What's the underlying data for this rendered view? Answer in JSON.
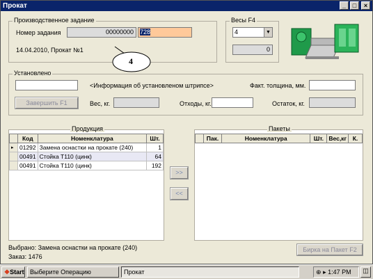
{
  "window": {
    "title": "Прокат"
  },
  "task": {
    "group_label": "Производственное задание",
    "number_label": "Номер задания",
    "number_value": "00000000",
    "number_edit_value": "728",
    "info": "14.04.2010, Прокат №1",
    "callout": "4"
  },
  "scales": {
    "group_label": "Весы  F4",
    "selected": "4",
    "reading": "0"
  },
  "installed": {
    "group_label": "Установлено",
    "strip_info": "<Информация об установленом штрипсе>",
    "thickness_label": "Факт. толщина, мм.",
    "finish_button": "Завершить     F1",
    "weight_label": "Вес, кг.",
    "waste_label": "Отходы, кг.",
    "remainder_label": "Остаток, кг."
  },
  "products": {
    "group_label": "Продукция",
    "columns": [
      "Код",
      "Номенклатура",
      "Шт."
    ],
    "rows": [
      {
        "code": "01292",
        "name": "Замена оснастки на прокате (240)",
        "qty": "1"
      },
      {
        "code": "00491",
        "name": "Стойка Т110 (цинк)",
        "qty": "64"
      },
      {
        "code": "00491",
        "name": "Стойка Т110 (цинк)",
        "qty": "192"
      }
    ]
  },
  "transfer": {
    "forward": ">>",
    "back": "<<"
  },
  "packages": {
    "group_label": "Пакеты",
    "columns": [
      "Пак.",
      "Номенклатура",
      "Шт.",
      "Вес,кг",
      "К."
    ],
    "label_button": "Бирка на Пакет   F2"
  },
  "status": {
    "selected": "Выбрано: Замена оснастки на прокате (240)",
    "order": "Заказ: 1476"
  },
  "taskbar": {
    "start": "Start",
    "item1": "Выберите Операцию",
    "item2": "Прокат",
    "clock": "1:47 PM"
  }
}
